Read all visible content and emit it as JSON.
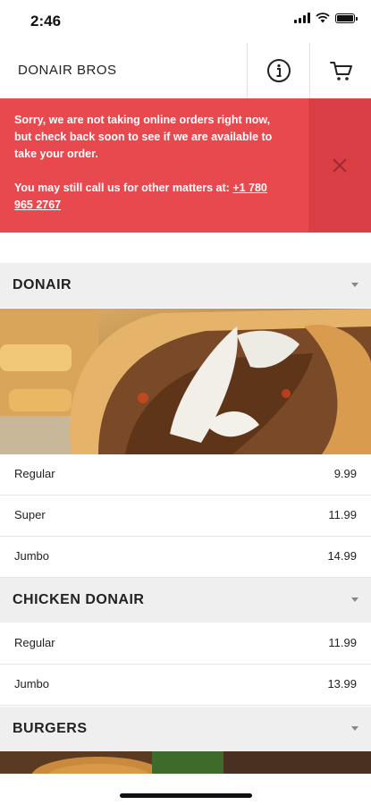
{
  "status_bar": {
    "time": "2:46"
  },
  "header": {
    "brand": "DONAIR BROS"
  },
  "alert": {
    "message": "Sorry, we are not taking online orders right now, but check back soon to see if we are available to take your order.",
    "call_prefix": "You may still call us for other matters at:",
    "phone": "+1 780 965 2767"
  },
  "menu": {
    "donair": {
      "title": "DONAIR",
      "items": [
        {
          "name": "Regular",
          "price": "9.99"
        },
        {
          "name": "Super",
          "price": "11.99"
        },
        {
          "name": "Jumbo",
          "price": "14.99"
        }
      ]
    },
    "chicken_donair": {
      "title": "CHICKEN DONAIR",
      "items": [
        {
          "name": "Regular",
          "price": "11.99"
        },
        {
          "name": "Jumbo",
          "price": "13.99"
        }
      ]
    },
    "burgers": {
      "title": "BURGERS"
    }
  },
  "colors": {
    "alert_bg": "#e8494f",
    "alert_close_bg": "#d93f45",
    "category_bg": "#efefef"
  }
}
